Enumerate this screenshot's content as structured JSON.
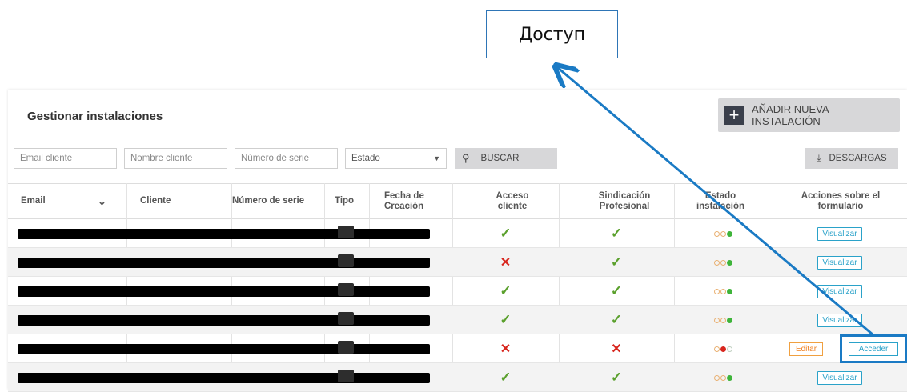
{
  "callout": {
    "text": "Доступ"
  },
  "header": {
    "title": "Gestionar instalaciones",
    "add_button": "AÑADIR NUEVA INSTALACIÓN"
  },
  "filters": {
    "email_placeholder": "Email cliente",
    "nombre_placeholder": "Nombre cliente",
    "serie_placeholder": "Número de serie",
    "estado_label": "Estado",
    "buscar_label": "BUSCAR",
    "descargas_label": "DESCARGAS"
  },
  "columns": {
    "email": "Email",
    "cliente": "Cliente",
    "numero_serie": "Número de serie",
    "tipo": "Tipo",
    "fecha": "Fecha de Creación",
    "acceso": "Acceso cliente",
    "sindicacion": "Sindicación Profesional",
    "estado": "Estado instalación",
    "acciones": "Acciones sobre el formulario"
  },
  "rows": [
    {
      "acceso": "check",
      "sindicacion": "check",
      "estado": "green",
      "actions": [
        "Visualizar"
      ]
    },
    {
      "acceso": "cross",
      "sindicacion": "check",
      "estado": "green",
      "actions": [
        "Visualizar"
      ]
    },
    {
      "acceso": "check",
      "sindicacion": "check",
      "estado": "green",
      "actions": [
        "Visualizar"
      ]
    },
    {
      "acceso": "check",
      "sindicacion": "check",
      "estado": "green",
      "actions": [
        "Visualizar"
      ]
    },
    {
      "acceso": "cross",
      "sindicacion": "cross",
      "estado": "red",
      "actions": [
        "Editar",
        "Acceder"
      ]
    },
    {
      "acceso": "check",
      "sindicacion": "check",
      "estado": "green",
      "actions": [
        "Visualizar"
      ]
    }
  ],
  "symbols": {
    "check": "✓",
    "cross": "✕",
    "plus": "+",
    "search": "⚲",
    "download": "⤓",
    "chevron": "⌄",
    "caret": "▼"
  },
  "colors": {
    "accent": "#2aa2c9",
    "check": "#5aa02c",
    "cross": "#d8261e",
    "annotation": "#1a7ac4"
  }
}
